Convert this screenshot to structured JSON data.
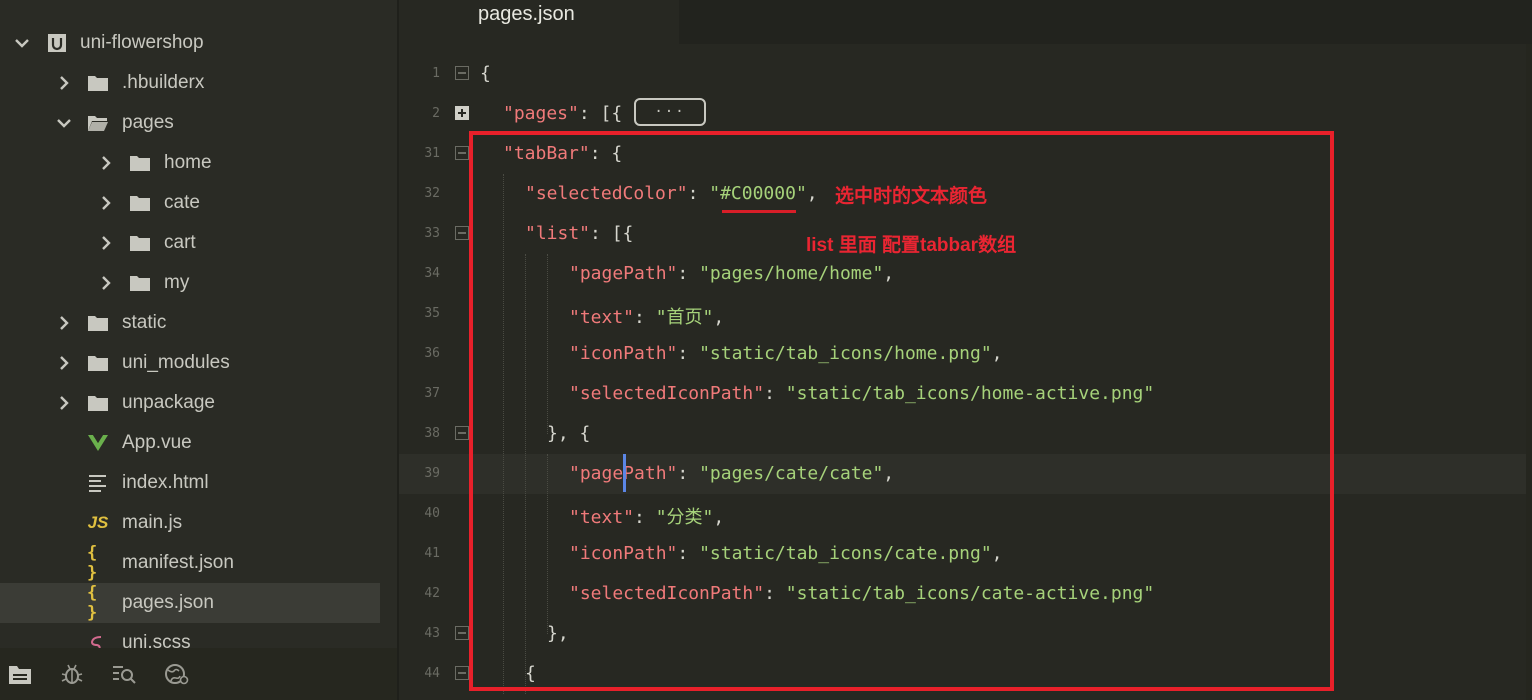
{
  "tab": {
    "active_label": "pages.json"
  },
  "sidebar": {
    "project": {
      "label": "uni-flowershop",
      "icon": "project-icon"
    },
    "items": [
      {
        "label": ".hbuilderx",
        "icon": "folder-icon",
        "chevron": "chevron-right-icon"
      },
      {
        "label": "pages",
        "icon": "folder-open-icon",
        "chevron": "chevron-down-icon"
      },
      {
        "label": "home",
        "icon": "folder-icon",
        "chevron": "chevron-right-icon"
      },
      {
        "label": "cate",
        "icon": "folder-icon",
        "chevron": "chevron-right-icon"
      },
      {
        "label": "cart",
        "icon": "folder-icon",
        "chevron": "chevron-right-icon"
      },
      {
        "label": "my",
        "icon": "folder-icon",
        "chevron": "chevron-right-icon"
      },
      {
        "label": "static",
        "icon": "folder-icon",
        "chevron": "chevron-right-icon"
      },
      {
        "label": "uni_modules",
        "icon": "folder-icon",
        "chevron": "chevron-right-icon"
      },
      {
        "label": "unpackage",
        "icon": "folder-icon",
        "chevron": "chevron-right-icon"
      },
      {
        "label": "App.vue",
        "icon": "vue-icon"
      },
      {
        "label": "index.html",
        "icon": "file-lines-icon"
      },
      {
        "label": "main.js",
        "icon": "js-icon"
      },
      {
        "label": "manifest.json",
        "icon": "json-icon"
      },
      {
        "label": "pages.json",
        "icon": "json-icon",
        "selected": true
      },
      {
        "label": "uni.scss",
        "icon": "sass-icon"
      }
    ],
    "icon_text": {
      "js": "JS",
      "json": "{ }"
    },
    "bottom_icons": [
      "files-icon",
      "debug-bug-icon",
      "search-list-icon",
      "browser-icon"
    ]
  },
  "editor": {
    "fold_placeholder": "···",
    "lines": [
      {
        "num": "1",
        "fold": "open",
        "tokens": [
          {
            "t": "{",
            "c": "p"
          }
        ]
      },
      {
        "num": "2",
        "fold": "closed",
        "tokens": [
          {
            "t": "\"pages\"",
            "c": "k"
          },
          {
            "t": ": [{",
            "c": "p"
          }
        ]
      },
      {
        "num": "31",
        "fold": "open",
        "tokens": [
          {
            "t": "\"tabBar\"",
            "c": "k"
          },
          {
            "t": ": {",
            "c": "p"
          }
        ]
      },
      {
        "num": "32",
        "tokens": [
          {
            "t": "\"selectedColor\"",
            "c": "k"
          },
          {
            "t": ": ",
            "c": "p"
          },
          {
            "t": "\"#C00000\"",
            "c": "s"
          },
          {
            "t": ",",
            "c": "p"
          }
        ]
      },
      {
        "num": "33",
        "fold": "open",
        "tokens": [
          {
            "t": "\"list\"",
            "c": "k"
          },
          {
            "t": ": [{",
            "c": "p"
          }
        ]
      },
      {
        "num": "34",
        "tokens": [
          {
            "t": "\"pagePath\"",
            "c": "k"
          },
          {
            "t": ": ",
            "c": "p"
          },
          {
            "t": "\"pages/home/home\"",
            "c": "s"
          },
          {
            "t": ",",
            "c": "p"
          }
        ]
      },
      {
        "num": "35",
        "tokens": [
          {
            "t": "\"text\"",
            "c": "k"
          },
          {
            "t": ": ",
            "c": "p"
          },
          {
            "t": "\"首页\"",
            "c": "s"
          },
          {
            "t": ",",
            "c": "p"
          }
        ]
      },
      {
        "num": "36",
        "tokens": [
          {
            "t": "\"iconPath\"",
            "c": "k"
          },
          {
            "t": ": ",
            "c": "p"
          },
          {
            "t": "\"static/tab_icons/home.png\"",
            "c": "s"
          },
          {
            "t": ",",
            "c": "p"
          }
        ]
      },
      {
        "num": "37",
        "tokens": [
          {
            "t": "\"selectedIconPath\"",
            "c": "k"
          },
          {
            "t": ": ",
            "c": "p"
          },
          {
            "t": "\"static/tab_icons/home-active.png\"",
            "c": "s"
          }
        ]
      },
      {
        "num": "38",
        "fold": "open",
        "tokens": [
          {
            "t": "}, {",
            "c": "p"
          }
        ]
      },
      {
        "num": "39",
        "current": true,
        "tokens": [
          {
            "t": "\"pagePath\"",
            "c": "k"
          },
          {
            "t": ": ",
            "c": "p"
          },
          {
            "t": "\"pages/cate/cate\"",
            "c": "s"
          },
          {
            "t": ",",
            "c": "p"
          }
        ]
      },
      {
        "num": "40",
        "tokens": [
          {
            "t": "\"text\"",
            "c": "k"
          },
          {
            "t": ": ",
            "c": "p"
          },
          {
            "t": "\"分类\"",
            "c": "s"
          },
          {
            "t": ",",
            "c": "p"
          }
        ]
      },
      {
        "num": "41",
        "tokens": [
          {
            "t": "\"iconPath\"",
            "c": "k"
          },
          {
            "t": ": ",
            "c": "p"
          },
          {
            "t": "\"static/tab_icons/cate.png\"",
            "c": "s"
          },
          {
            "t": ",",
            "c": "p"
          }
        ]
      },
      {
        "num": "42",
        "tokens": [
          {
            "t": "\"selectedIconPath\"",
            "c": "k"
          },
          {
            "t": ": ",
            "c": "p"
          },
          {
            "t": "\"static/tab_icons/cate-active.png\"",
            "c": "s"
          }
        ]
      },
      {
        "num": "43",
        "fold": "open",
        "tokens": [
          {
            "t": "},",
            "c": "p"
          }
        ]
      },
      {
        "num": "44",
        "fold": "open",
        "tokens": [
          {
            "t": "{",
            "c": "p"
          }
        ]
      }
    ]
  },
  "annotations": {
    "selected_color_note": "选中时的文本颜色",
    "list_note": "list 里面 配置tabbar数组"
  },
  "colors": {
    "annotation": "#ea2532",
    "key": "#f07a7a",
    "string": "#a6d27a",
    "caret": "#5b86e6"
  }
}
